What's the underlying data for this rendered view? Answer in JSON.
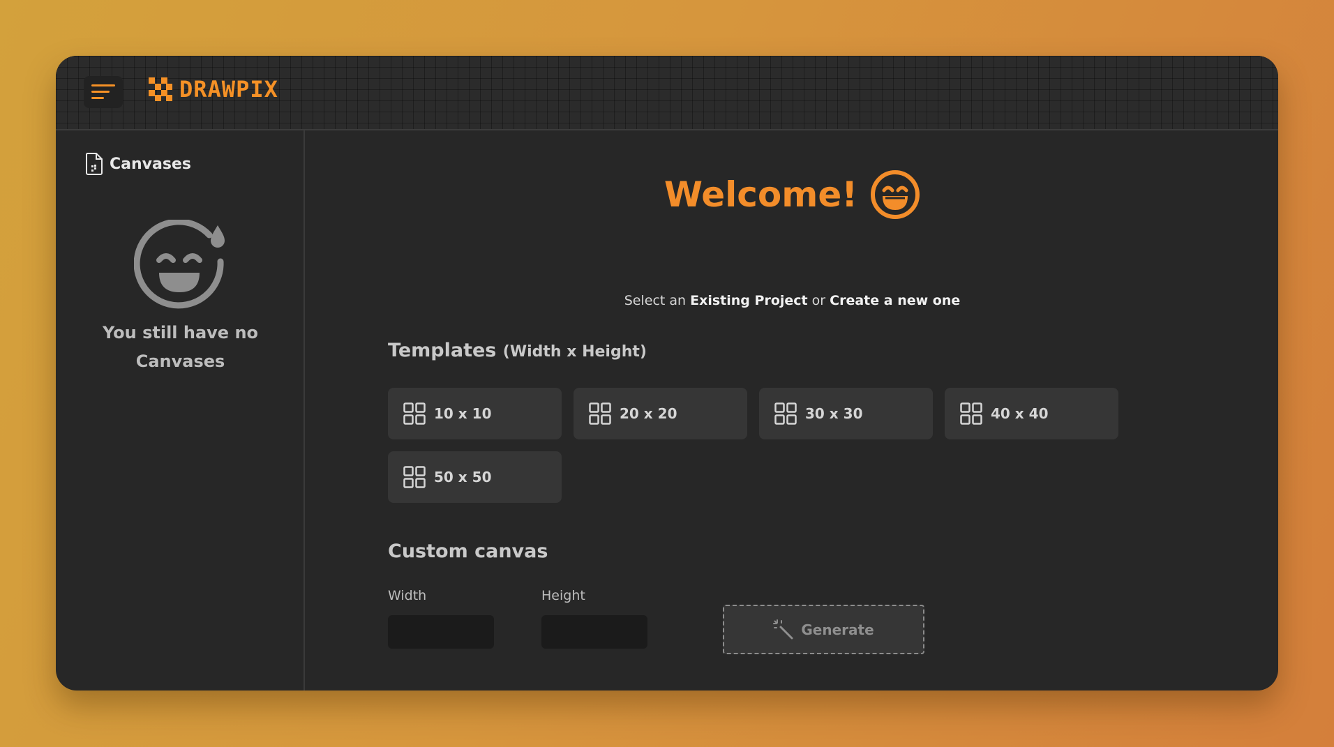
{
  "app": {
    "name": "DRAWPIX",
    "brand_color": "#f59126",
    "menu_icon": "hamburger-menu-icon",
    "logo_icon": "pixel-checker-logo-icon"
  },
  "sidebar": {
    "title": "Canvases",
    "title_icon": "document-icon",
    "empty_icon": "sweat-smile-face-icon",
    "empty_line1": "You still have no",
    "empty_line2": "Canvases"
  },
  "main": {
    "welcome_title": "Welcome!",
    "welcome_icon": "grin-face-icon",
    "subtitle": {
      "prefix": "Select an",
      "existing": "Existing Project",
      "middle": "or",
      "create": "Create a new one"
    },
    "templates": {
      "title": "Templates",
      "subtitle": "(Width x Height)",
      "items": [
        {
          "label": "10 x 10"
        },
        {
          "label": "20 x 20"
        },
        {
          "label": "30 x 30"
        },
        {
          "label": "40 x 40"
        },
        {
          "label": "50 x 50"
        }
      ]
    },
    "custom": {
      "title": "Custom canvas",
      "width_label": "Width",
      "height_label": "Height",
      "width_value": "",
      "height_value": "",
      "times": "×",
      "generate_label": "Generate",
      "generate_icon": "magic-wand-icon"
    }
  }
}
